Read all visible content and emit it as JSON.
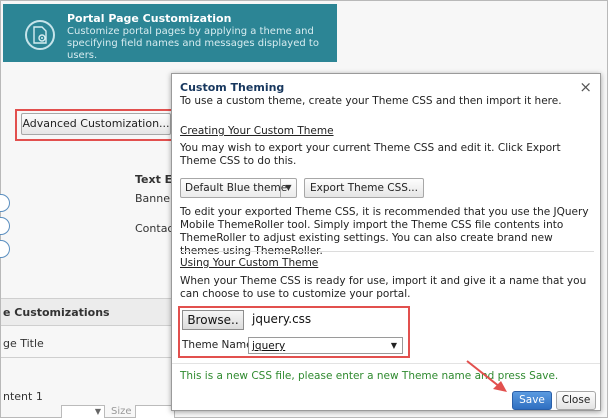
{
  "background": {
    "banner": {
      "title": "Portal Page Customization",
      "description": "Customize portal pages by applying a theme and specifying field names and messages displayed to users."
    },
    "advanced_button": "Advanced Customization...",
    "text_elements_label": "Text El",
    "banner_label": "Banner",
    "contact_label": "Contact",
    "customizations_header": "e Customizations",
    "page_title_label": "ge Title",
    "content_label": "ntent 1",
    "size_label": "Size"
  },
  "dialog": {
    "title": "Custom Theming",
    "close_symbol": "×",
    "intro": "To use a custom theme, create your Theme CSS and then import it here.",
    "creating_heading": "Creating Your Custom Theme",
    "export_text": "You may wish to export your current Theme CSS and edit it. Click Export Theme CSS to do this.",
    "theme_select": {
      "value": "Default Blue theme"
    },
    "export_button": "Export Theme CSS...",
    "themeroller_text": "To edit your exported Theme CSS, it is recommended that you use the JQuery Mobile ThemeRoller tool. Simply import the Theme CSS file contents into ThemeRoller to adjust existing settings. You can also create brand new themes using ThemeRoller.",
    "using_heading": "Using Your Custom Theme",
    "ready_text": "When your Theme CSS is ready for use, import it and give it a name that you can choose to use to customize your portal.",
    "browse_button": "Browse..",
    "file_name": "jquery.css",
    "theme_name_label": "Theme Name:",
    "theme_name_value": "jquery",
    "hint": "This is a new CSS file, please enter a new Theme name and press Save.",
    "save_button": "Save",
    "close_button": "Close"
  },
  "colors": {
    "banner": "#2c8595",
    "highlight_frame": "#e2504e",
    "save_button": "#2f6fc1",
    "hint_text": "#2f8a2f"
  }
}
